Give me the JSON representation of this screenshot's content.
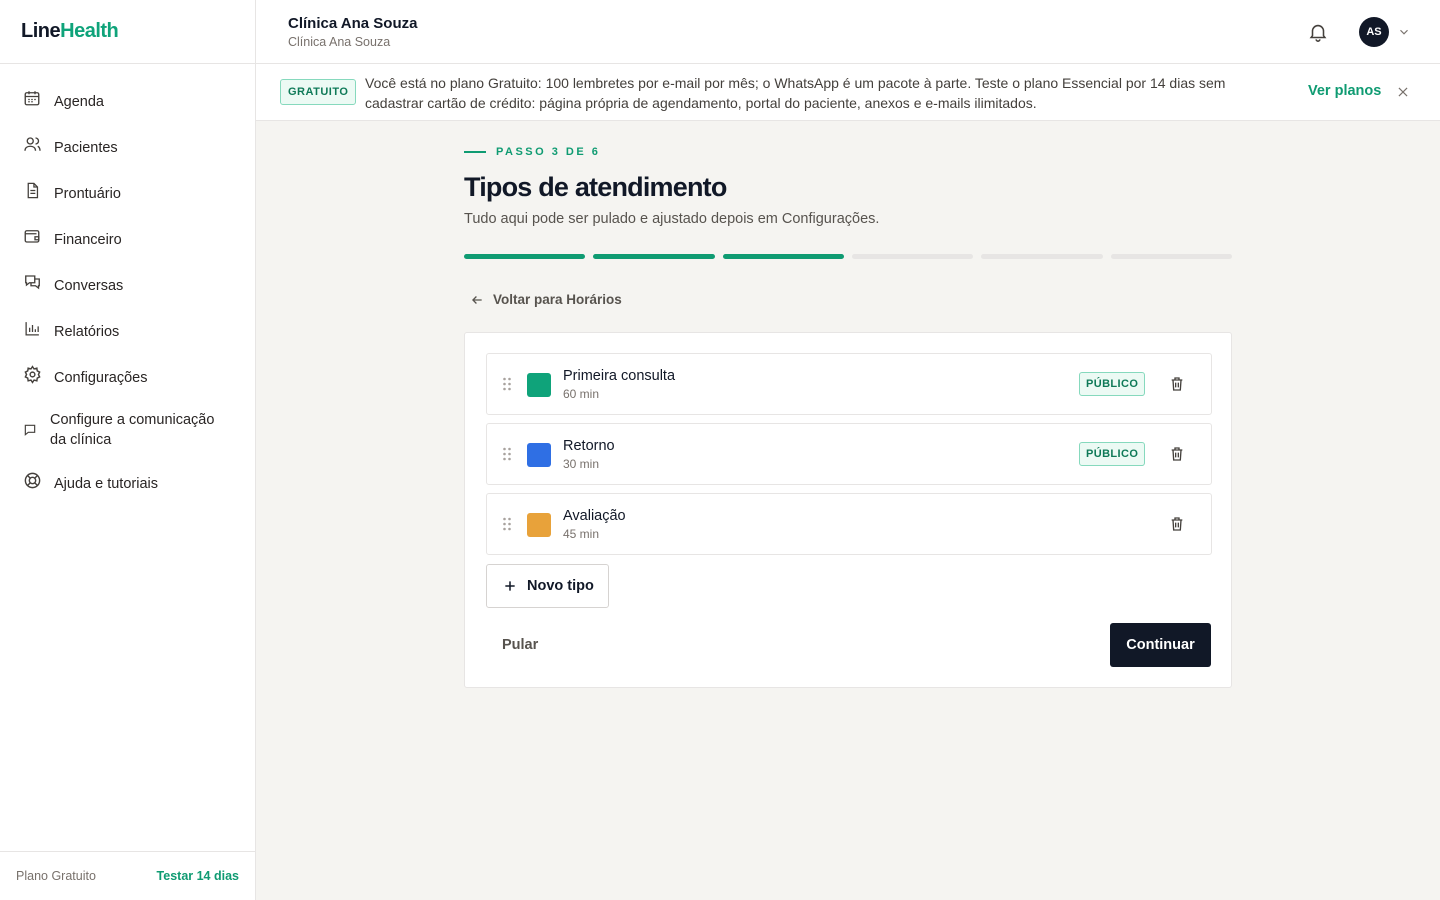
{
  "brand": {
    "part1": "Line",
    "part2": "Health"
  },
  "sidebar": {
    "items": [
      {
        "label": "Agenda",
        "icon": "calendar-icon"
      },
      {
        "label": "Pacientes",
        "icon": "users-icon"
      },
      {
        "label": "Prontuário",
        "icon": "document-icon"
      },
      {
        "label": "Financeiro",
        "icon": "wallet-icon"
      },
      {
        "label": "Conversas",
        "icon": "chat-icon"
      },
      {
        "label": "Relatórios",
        "icon": "bar-chart-icon"
      },
      {
        "label": "Configurações",
        "icon": "gear-icon"
      },
      {
        "label": "Configure a comunicação da clínica",
        "icon": "message-icon"
      },
      {
        "label": "Ajuda e tutoriais",
        "icon": "lifebuoy-icon"
      }
    ],
    "footer": {
      "plan": "Plano Gratuito",
      "trial": "Testar 14 dias"
    }
  },
  "header": {
    "clinic_name": "Clínica Ana Souza",
    "clinic_sub": "Clínica Ana Souza",
    "avatar_initials": "AS"
  },
  "banner": {
    "badge": "GRATUITO",
    "text": "Você está no plano Gratuito: 100 lembretes por e-mail por mês; o WhatsApp é um pacote à parte. Teste o plano Essencial por 14 dias sem cadastrar cartão de crédito: página própria de agendamento, portal do paciente, anexos e e-mails ilimitados.",
    "link": "Ver planos"
  },
  "wizard": {
    "step_label": "PASSO 3 DE 6",
    "current_step": 3,
    "total_steps": 6,
    "title": "Tipos de atendimento",
    "subtitle": "Tudo aqui pode ser pulado e ajustado depois em Configurações.",
    "back_label": "Voltar para Horários",
    "types": [
      {
        "name": "Primeira consulta",
        "duration": "60 min",
        "color": "#0fa37a",
        "badge": "PÚBLICO"
      },
      {
        "name": "Retorno",
        "duration": "30 min",
        "color": "#2f6fe4",
        "badge": "PÚBLICO"
      },
      {
        "name": "Avaliação",
        "duration": "45 min",
        "color": "#e8a23a",
        "badge": ""
      }
    ],
    "add_label": "Novo tipo",
    "skip_label": "Pular",
    "continue_label": "Continuar"
  },
  "colors": {
    "accent": "#0f9b72",
    "dark": "#111827"
  }
}
